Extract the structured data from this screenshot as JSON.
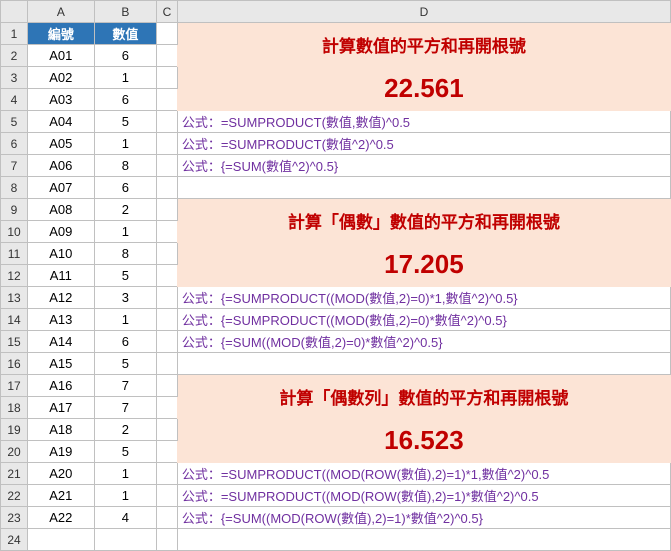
{
  "cols": {
    "A": "A",
    "B": "B",
    "C": "C",
    "D": "D"
  },
  "hdr": {
    "id": "編號",
    "val": "數值"
  },
  "rows": [
    {
      "n": "1"
    },
    {
      "n": "2",
      "id": "A01",
      "v": "6"
    },
    {
      "n": "3",
      "id": "A02",
      "v": "1"
    },
    {
      "n": "4",
      "id": "A03",
      "v": "6"
    },
    {
      "n": "5",
      "id": "A04",
      "v": "5"
    },
    {
      "n": "6",
      "id": "A05",
      "v": "1"
    },
    {
      "n": "7",
      "id": "A06",
      "v": "8"
    },
    {
      "n": "8",
      "id": "A07",
      "v": "6"
    },
    {
      "n": "9",
      "id": "A08",
      "v": "2"
    },
    {
      "n": "10",
      "id": "A09",
      "v": "1"
    },
    {
      "n": "11",
      "id": "A10",
      "v": "8"
    },
    {
      "n": "12",
      "id": "A11",
      "v": "5"
    },
    {
      "n": "13",
      "id": "A12",
      "v": "3"
    },
    {
      "n": "14",
      "id": "A13",
      "v": "1"
    },
    {
      "n": "15",
      "id": "A14",
      "v": "6"
    },
    {
      "n": "16",
      "id": "A15",
      "v": "5"
    },
    {
      "n": "17",
      "id": "A16",
      "v": "7"
    },
    {
      "n": "18",
      "id": "A17",
      "v": "7"
    },
    {
      "n": "19",
      "id": "A18",
      "v": "2"
    },
    {
      "n": "20",
      "id": "A19",
      "v": "5"
    },
    {
      "n": "21",
      "id": "A20",
      "v": "1"
    },
    {
      "n": "22",
      "id": "A21",
      "v": "1"
    },
    {
      "n": "23",
      "id": "A22",
      "v": "4"
    },
    {
      "n": "24"
    }
  ],
  "s1": {
    "title": "計算數值的平方和再開根號",
    "result": "22.561",
    "f1": "公式：=SUMPRODUCT(數值,數值)^0.5",
    "f2": "公式：=SUMPRODUCT(數值^2)^0.5",
    "f3": "公式：{=SUM(數值^2)^0.5}"
  },
  "s2": {
    "title": "計算「偶數」數值的平方和再開根號",
    "result": "17.205",
    "f1": "公式：{=SUMPRODUCT((MOD(數值,2)=0)*1,數值^2)^0.5}",
    "f2": "公式：{=SUMPRODUCT((MOD(數值,2)=0)*數值^2)^0.5}",
    "f3": "公式：{=SUM((MOD(數值,2)=0)*數值^2)^0.5}"
  },
  "s3": {
    "title": "計算「偶數列」數值的平方和再開根號",
    "result": "16.523",
    "f1": "公式：=SUMPRODUCT((MOD(ROW(數值),2)=1)*1,數值^2)^0.5",
    "f2": "公式：=SUMPRODUCT((MOD(ROW(數值),2)=1)*數值^2)^0.5",
    "f3": "公式：{=SUM((MOD(ROW(數值),2)=1)*數值^2)^0.5}"
  }
}
